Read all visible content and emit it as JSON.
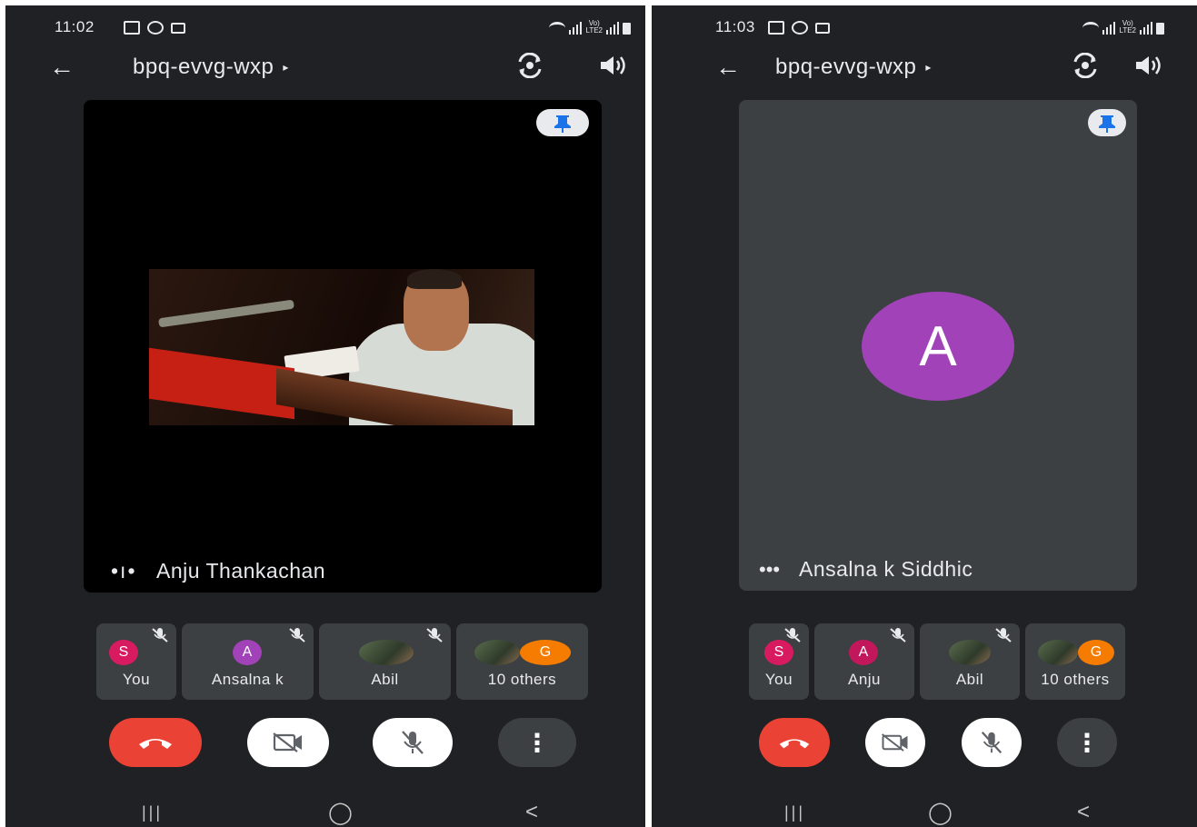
{
  "left": {
    "status": {
      "time": "11:02"
    },
    "meeting_code": "bpq-evvg-wxp",
    "main_tile": {
      "name": "Anju Thankachan",
      "speaking_indicator": "•ı•"
    },
    "participants": [
      {
        "label": "You",
        "initial": "S",
        "color": "#d81b60"
      },
      {
        "label": "Ansalna k",
        "initial": "A",
        "color": "#a142b8"
      },
      {
        "label": "Abil",
        "initial": "",
        "color": ""
      },
      {
        "label": "10 others",
        "initial": "G",
        "color": "#f57c00"
      }
    ]
  },
  "right": {
    "status": {
      "time": "11:03"
    },
    "meeting_code": "bpq-evvg-wxp",
    "main_tile": {
      "name": "Ansalna k Siddhic",
      "avatar_initial": "A",
      "avatar_color": "#a142b8",
      "menu_glyph": "•••"
    },
    "participants": [
      {
        "label": "You",
        "initial": "S",
        "color": "#d81b60"
      },
      {
        "label": "Anju",
        "initial": "A",
        "color": "#c2185b"
      },
      {
        "label": "Abil",
        "initial": "",
        "color": ""
      },
      {
        "label": "10 others",
        "initial": "G",
        "color": "#f57c00"
      }
    ]
  },
  "icons": {
    "back": "←",
    "dropdown": "▸",
    "nav_recents": "|||",
    "nav_home": "◯",
    "nav_back": "<",
    "more": "⋮"
  },
  "colors": {
    "end_call": "#ea4335",
    "pin": "#1a73e8",
    "background": "#202124",
    "tile": "#3c4043"
  }
}
